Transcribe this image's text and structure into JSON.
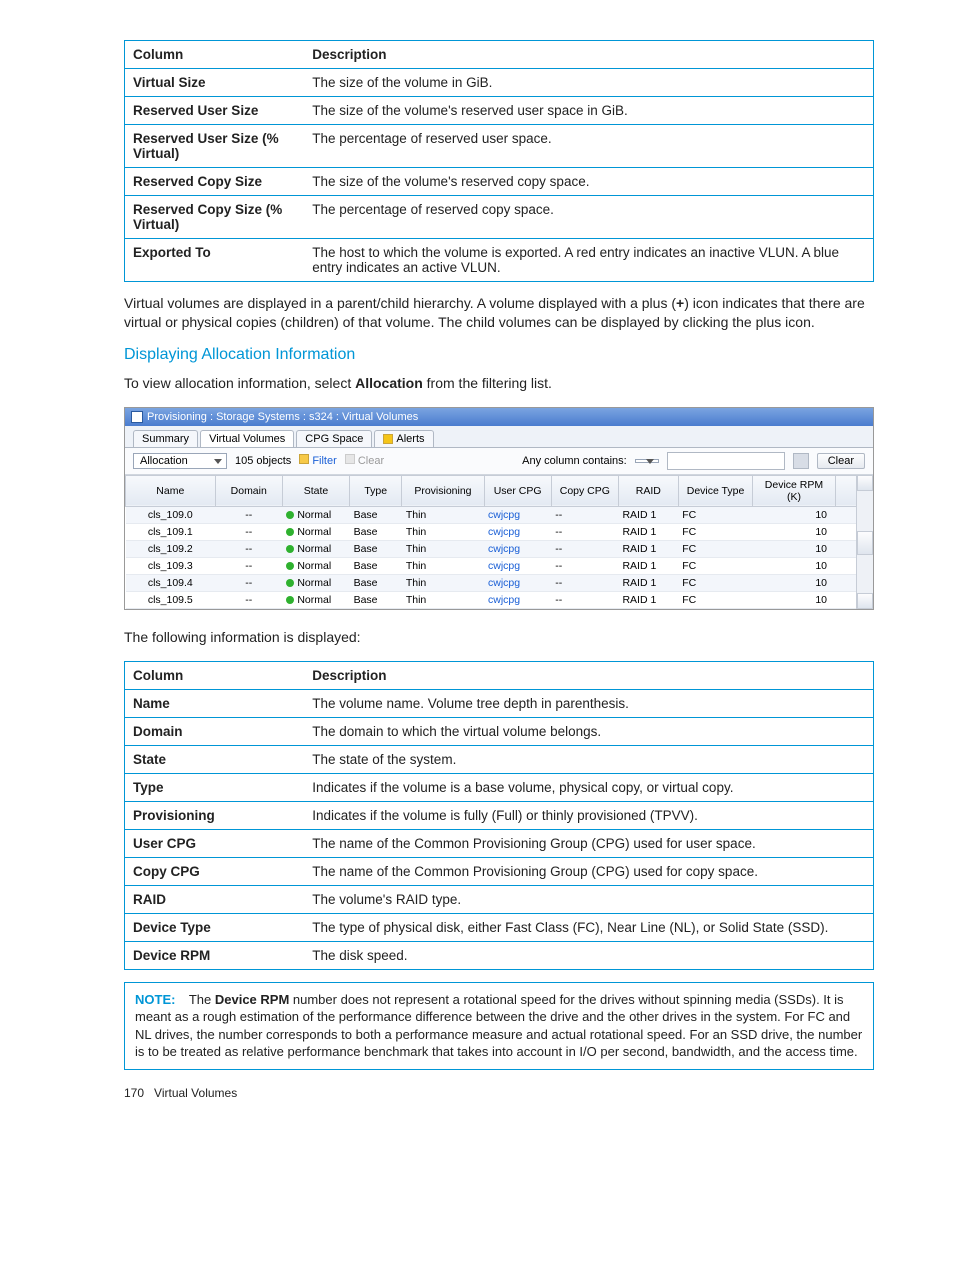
{
  "table1": {
    "head": {
      "c1": "Column",
      "c2": "Description"
    },
    "rows": [
      {
        "c1": "Virtual Size",
        "c2": "The size of the volume in GiB."
      },
      {
        "c1": "Reserved User Size",
        "c2": "The size of the volume's reserved user space in GiB."
      },
      {
        "c1": "Reserved User Size (% Virtual)",
        "c2": "The percentage of reserved user space."
      },
      {
        "c1": "Reserved Copy Size",
        "c2": "The size of the volume's reserved copy space."
      },
      {
        "c1": "Reserved Copy Size (% Virtual)",
        "c2": "The percentage of reserved copy space."
      },
      {
        "c1": "Exported To",
        "c2": "The host to which the volume is exported. A red entry indicates an inactive VLUN. A blue entry indicates an active VLUN."
      }
    ]
  },
  "para1a": "Virtual volumes are displayed in a parent/child hierarchy. A volume displayed with a plus (",
  "para1b": "+",
  "para1c": ") icon indicates that there are virtual or physical copies (children) of that volume. The child volumes can be displayed by clicking the plus icon.",
  "heading1": "Displaying Allocation Information",
  "para2a": "To view allocation information, select ",
  "para2b": "Allocation",
  "para2c": " from the filtering list.",
  "shot": {
    "title": "Provisioning : Storage Systems : s324 : Virtual Volumes",
    "tabs": [
      "Summary",
      "Virtual Volumes",
      "CPG Space",
      "Alerts"
    ],
    "activeTab": 1,
    "dropdown": "Allocation",
    "count": "105 objects",
    "filter": "Filter",
    "clear1": "Clear",
    "anycol": "Any column contains:",
    "clear2": "Clear",
    "headers": [
      "Name",
      "Domain",
      "State",
      "Type",
      "Provisioning",
      "User CPG",
      "Copy CPG",
      "RAID",
      "Device Type",
      "Device RPM (K)"
    ],
    "rows": [
      {
        "name": "cls_109.0",
        "domain": "--",
        "state": "Normal",
        "type": "Base",
        "prov": "Thin",
        "ucpg": "cwjcpg",
        "ccpg": "--",
        "raid": "RAID 1",
        "dtype": "FC",
        "rpm": "10"
      },
      {
        "name": "cls_109.1",
        "domain": "--",
        "state": "Normal",
        "type": "Base",
        "prov": "Thin",
        "ucpg": "cwjcpg",
        "ccpg": "--",
        "raid": "RAID 1",
        "dtype": "FC",
        "rpm": "10"
      },
      {
        "name": "cls_109.2",
        "domain": "--",
        "state": "Normal",
        "type": "Base",
        "prov": "Thin",
        "ucpg": "cwjcpg",
        "ccpg": "--",
        "raid": "RAID 1",
        "dtype": "FC",
        "rpm": "10"
      },
      {
        "name": "cls_109.3",
        "domain": "--",
        "state": "Normal",
        "type": "Base",
        "prov": "Thin",
        "ucpg": "cwjcpg",
        "ccpg": "--",
        "raid": "RAID 1",
        "dtype": "FC",
        "rpm": "10"
      },
      {
        "name": "cls_109.4",
        "domain": "--",
        "state": "Normal",
        "type": "Base",
        "prov": "Thin",
        "ucpg": "cwjcpg",
        "ccpg": "--",
        "raid": "RAID 1",
        "dtype": "FC",
        "rpm": "10"
      },
      {
        "name": "cls_109.5",
        "domain": "--",
        "state": "Normal",
        "type": "Base",
        "prov": "Thin",
        "ucpg": "cwjcpg",
        "ccpg": "--",
        "raid": "RAID 1",
        "dtype": "FC",
        "rpm": "10"
      }
    ]
  },
  "para3": "The following information is displayed:",
  "table2": {
    "head": {
      "c1": "Column",
      "c2": "Description"
    },
    "rows": [
      {
        "c1": "Name",
        "c2": "The volume name. Volume tree depth in parenthesis."
      },
      {
        "c1": "Domain",
        "c2": "The domain to which the virtual volume belongs."
      },
      {
        "c1": "State",
        "c2": "The state of the system."
      },
      {
        "c1": "Type",
        "c2": "Indicates if the volume is a base volume, physical copy, or virtual copy."
      },
      {
        "c1": "Provisioning",
        "c2": "Indicates if the volume is fully (Full) or thinly provisioned (TPVV)."
      },
      {
        "c1": "User CPG",
        "c2": "The name of the Common Provisioning Group (CPG) used for user space."
      },
      {
        "c1": "Copy CPG",
        "c2": "The name of the Common Provisioning Group (CPG) used for copy space."
      },
      {
        "c1": "RAID",
        "c2": "The volume's RAID type."
      },
      {
        "c1": "Device Type",
        "c2": "The type of physical disk, either Fast Class (FC), Near Line (NL), or Solid State (SSD)."
      },
      {
        "c1": "Device RPM",
        "c2": "The disk speed."
      }
    ]
  },
  "note": {
    "label": "NOTE:",
    "text1": "The ",
    "bold": "Device RPM",
    "text2": " number does not represent a rotational speed for the drives without spinning media (SSDs). It is meant as a rough estimation of the performance difference between the drive and the other drives in the system. For FC and NL drives, the number corresponds to both a performance measure and actual rotational speed. For an SSD drive, the number is to be treated as relative performance benchmark that takes into account in I/O per second, bandwidth, and the access time."
  },
  "footer": {
    "page": "170",
    "title": "Virtual Volumes"
  }
}
